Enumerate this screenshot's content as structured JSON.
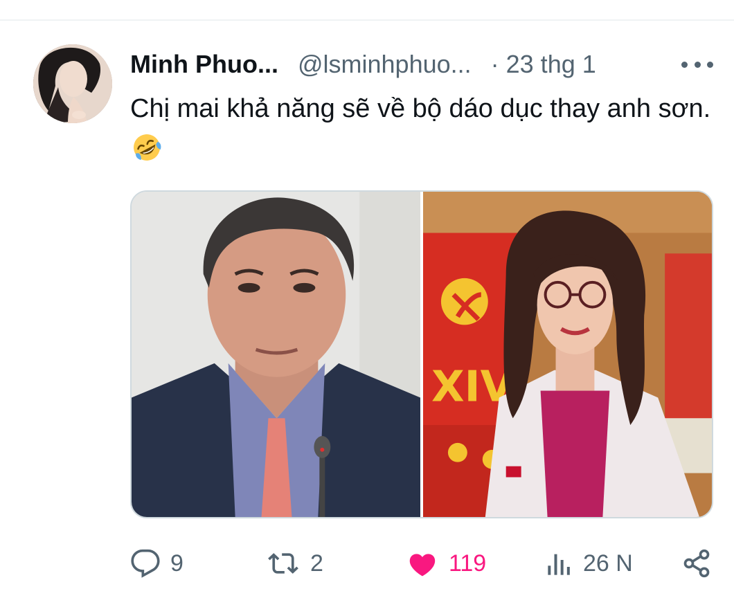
{
  "tweet": {
    "author": {
      "display_name": "Minh Phuo...",
      "handle": "@lsminhphuo...",
      "separator": "·",
      "date": "23 thg 1"
    },
    "text": "Chị mai khả năng sẽ về bộ dáo dục thay anh sơn.",
    "emoji": "rolling-on-floor-laughing",
    "media": {
      "count": 2,
      "right_photo_banner_text": "XIV"
    },
    "stats": {
      "replies": "9",
      "retweets": "2",
      "likes": "119",
      "views": "26 N"
    },
    "liked": true
  },
  "icons": {
    "more": "more-horizontal-icon",
    "reply": "speech-bubble-icon",
    "retweet": "retweet-arrows-icon",
    "like": "heart-filled-icon",
    "views": "bar-chart-icon",
    "share": "share-nodes-icon"
  },
  "colors": {
    "primary_text": "#0f1419",
    "secondary_text": "#536471",
    "like_pink": "#f91880",
    "border": "#cfd9de"
  }
}
